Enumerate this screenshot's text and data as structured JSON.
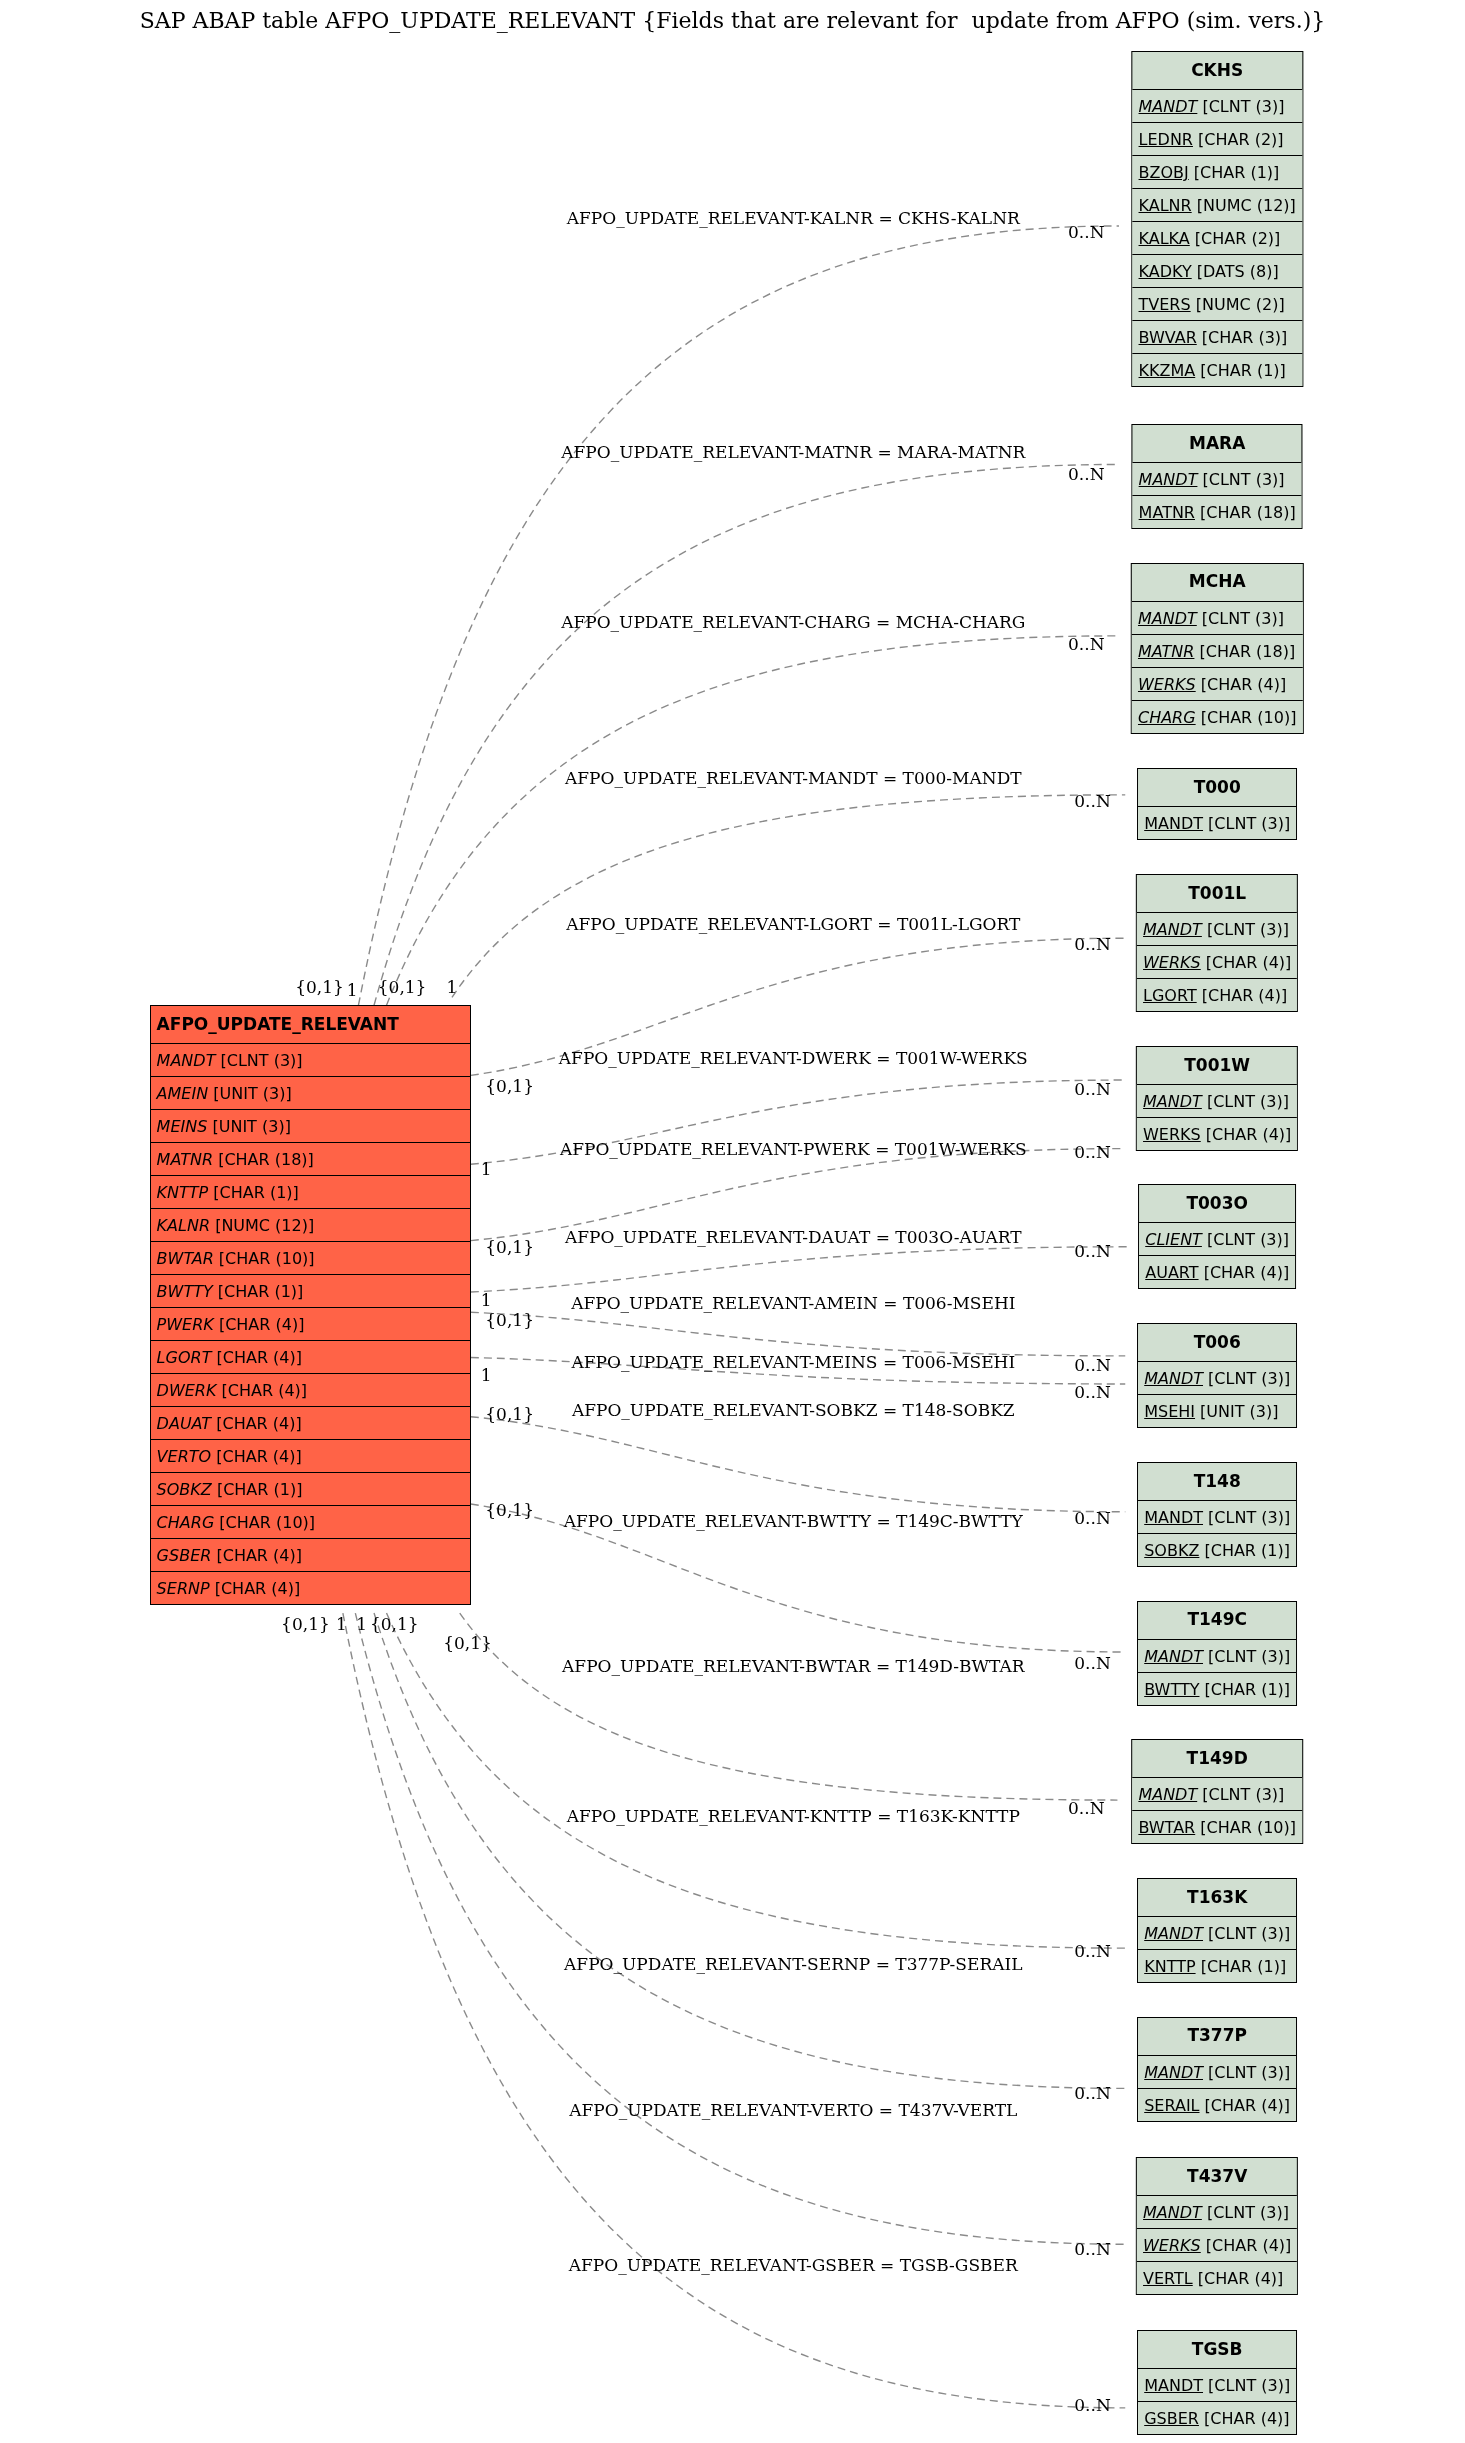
{
  "title": "SAP ABAP table AFPO_UPDATE_RELEVANT {Fields that are relevant for  update from AFPO (sim. vers.)}",
  "main_table": {
    "name": "AFPO_UPDATE_RELEVANT",
    "fields": [
      {
        "name": "MANDT",
        "type": "[CLNT (3)]",
        "italic": true,
        "underlined": false
      },
      {
        "name": "AMEIN",
        "type": "[UNIT (3)]",
        "italic": true,
        "underlined": false
      },
      {
        "name": "MEINS",
        "type": "[UNIT (3)]",
        "italic": true,
        "underlined": false
      },
      {
        "name": "MATNR",
        "type": "[CHAR (18)]",
        "italic": true,
        "underlined": false
      },
      {
        "name": "KNTTP",
        "type": "[CHAR (1)]",
        "italic": true,
        "underlined": false
      },
      {
        "name": "KALNR",
        "type": "[NUMC (12)]",
        "italic": true,
        "underlined": false
      },
      {
        "name": "BWTAR",
        "type": "[CHAR (10)]",
        "italic": true,
        "underlined": false
      },
      {
        "name": "BWTTY",
        "type": "[CHAR (1)]",
        "italic": true,
        "underlined": false
      },
      {
        "name": "PWERK",
        "type": "[CHAR (4)]",
        "italic": true,
        "underlined": false
      },
      {
        "name": "LGORT",
        "type": "[CHAR (4)]",
        "italic": true,
        "underlined": false
      },
      {
        "name": "DWERK",
        "type": "[CHAR (4)]",
        "italic": true,
        "underlined": false
      },
      {
        "name": "DAUAT",
        "type": "[CHAR (4)]",
        "italic": true,
        "underlined": false
      },
      {
        "name": "VERTO",
        "type": "[CHAR (4)]",
        "italic": true,
        "underlined": false
      },
      {
        "name": "SOBKZ",
        "type": "[CHAR (1)]",
        "italic": true,
        "underlined": false
      },
      {
        "name": "CHARG",
        "type": "[CHAR (10)]",
        "italic": true,
        "underlined": false
      },
      {
        "name": "GSBER",
        "type": "[CHAR (4)]",
        "italic": true,
        "underlined": false
      },
      {
        "name": "SERNP",
        "type": "[CHAR (4)]",
        "italic": true,
        "underlined": false
      }
    ]
  },
  "related_tables": [
    {
      "name": "CKHS",
      "fields": [
        {
          "name": "MANDT",
          "type": "[CLNT (3)]",
          "italic": true,
          "underlined": true
        },
        {
          "name": "LEDNR",
          "type": "[CHAR (2)]",
          "italic": false,
          "underlined": true
        },
        {
          "name": "BZOBJ",
          "type": "[CHAR (1)]",
          "italic": false,
          "underlined": true
        },
        {
          "name": "KALNR",
          "type": "[NUMC (12)]",
          "italic": false,
          "underlined": true
        },
        {
          "name": "KALKA",
          "type": "[CHAR (2)]",
          "italic": false,
          "underlined": true
        },
        {
          "name": "KADKY",
          "type": "[DATS (8)]",
          "italic": false,
          "underlined": true
        },
        {
          "name": "TVERS",
          "type": "[NUMC (2)]",
          "italic": false,
          "underlined": true
        },
        {
          "name": "BWVAR",
          "type": "[CHAR (3)]",
          "italic": false,
          "underlined": true
        },
        {
          "name": "KKZMA",
          "type": "[CHAR (1)]",
          "italic": false,
          "underlined": true
        }
      ]
    },
    {
      "name": "MARA",
      "fields": [
        {
          "name": "MANDT",
          "type": "[CLNT (3)]",
          "italic": true,
          "underlined": true
        },
        {
          "name": "MATNR",
          "type": "[CHAR (18)]",
          "italic": false,
          "underlined": true
        }
      ]
    },
    {
      "name": "MCHA",
      "fields": [
        {
          "name": "MANDT",
          "type": "[CLNT (3)]",
          "italic": true,
          "underlined": true
        },
        {
          "name": "MATNR",
          "type": "[CHAR (18)]",
          "italic": true,
          "underlined": true
        },
        {
          "name": "WERKS",
          "type": "[CHAR (4)]",
          "italic": true,
          "underlined": true
        },
        {
          "name": "CHARG",
          "type": "[CHAR (10)]",
          "italic": true,
          "underlined": true
        }
      ]
    },
    {
      "name": "T000",
      "fields": [
        {
          "name": "MANDT",
          "type": "[CLNT (3)]",
          "italic": false,
          "underlined": true
        }
      ]
    },
    {
      "name": "T001L",
      "fields": [
        {
          "name": "MANDT",
          "type": "[CLNT (3)]",
          "italic": true,
          "underlined": true
        },
        {
          "name": "WERKS",
          "type": "[CHAR (4)]",
          "italic": true,
          "underlined": true
        },
        {
          "name": "LGORT",
          "type": "[CHAR (4)]",
          "italic": false,
          "underlined": true
        }
      ]
    },
    {
      "name": "T001W",
      "fields": [
        {
          "name": "MANDT",
          "type": "[CLNT (3)]",
          "italic": true,
          "underlined": true
        },
        {
          "name": "WERKS",
          "type": "[CHAR (4)]",
          "italic": false,
          "underlined": true
        }
      ]
    },
    {
      "name": "T003O",
      "fields": [
        {
          "name": "CLIENT",
          "type": "[CLNT (3)]",
          "italic": true,
          "underlined": true
        },
        {
          "name": "AUART",
          "type": "[CHAR (4)]",
          "italic": false,
          "underlined": true
        }
      ]
    },
    {
      "name": "T006",
      "fields": [
        {
          "name": "MANDT",
          "type": "[CLNT (3)]",
          "italic": true,
          "underlined": true
        },
        {
          "name": "MSEHI",
          "type": "[UNIT (3)]",
          "italic": false,
          "underlined": true
        }
      ]
    },
    {
      "name": "T148",
      "fields": [
        {
          "name": "MANDT",
          "type": "[CLNT (3)]",
          "italic": false,
          "underlined": true
        },
        {
          "name": "SOBKZ",
          "type": "[CHAR (1)]",
          "italic": false,
          "underlined": true
        }
      ]
    },
    {
      "name": "T149C",
      "fields": [
        {
          "name": "MANDT",
          "type": "[CLNT (3)]",
          "italic": true,
          "underlined": true
        },
        {
          "name": "BWTTY",
          "type": "[CHAR (1)]",
          "italic": false,
          "underlined": true
        }
      ]
    },
    {
      "name": "T149D",
      "fields": [
        {
          "name": "MANDT",
          "type": "[CLNT (3)]",
          "italic": true,
          "underlined": true
        },
        {
          "name": "BWTAR",
          "type": "[CHAR (10)]",
          "italic": false,
          "underlined": true
        }
      ]
    },
    {
      "name": "T163K",
      "fields": [
        {
          "name": "MANDT",
          "type": "[CLNT (3)]",
          "italic": true,
          "underlined": true
        },
        {
          "name": "KNTTP",
          "type": "[CHAR (1)]",
          "italic": false,
          "underlined": true
        }
      ]
    },
    {
      "name": "T377P",
      "fields": [
        {
          "name": "MANDT",
          "type": "[CLNT (3)]",
          "italic": true,
          "underlined": true
        },
        {
          "name": "SERAIL",
          "type": "[CHAR (4)]",
          "italic": false,
          "underlined": true
        }
      ]
    },
    {
      "name": "T437V",
      "fields": [
        {
          "name": "MANDT",
          "type": "[CLNT (3)]",
          "italic": true,
          "underlined": true
        },
        {
          "name": "WERKS",
          "type": "[CHAR (4)]",
          "italic": true,
          "underlined": true
        },
        {
          "name": "VERTL",
          "type": "[CHAR (4)]",
          "italic": false,
          "underlined": true
        }
      ]
    },
    {
      "name": "TGSB",
      "fields": [
        {
          "name": "MANDT",
          "type": "[CLNT (3)]",
          "italic": false,
          "underlined": true
        },
        {
          "name": "GSBER",
          "type": "[CHAR (4)]",
          "italic": false,
          "underlined": true
        }
      ]
    }
  ],
  "relations": [
    {
      "label": "AFPO_UPDATE_RELEVANT-KALNR = CKHS-KALNR",
      "source_cardinality": "{0,1}",
      "target_cardinality": "0..N"
    },
    {
      "label": "AFPO_UPDATE_RELEVANT-MATNR = MARA-MATNR",
      "source_cardinality": "1",
      "target_cardinality": "0..N"
    },
    {
      "label": "AFPO_UPDATE_RELEVANT-CHARG = MCHA-CHARG",
      "source_cardinality": "{0,1}",
      "target_cardinality": "0..N"
    },
    {
      "label": "AFPO_UPDATE_RELEVANT-MANDT = T000-MANDT",
      "source_cardinality": "1",
      "target_cardinality": "0..N"
    },
    {
      "label": "AFPO_UPDATE_RELEVANT-LGORT = T001L-LGORT",
      "source_cardinality": "{0,1}",
      "target_cardinality": "0..N"
    },
    {
      "label": "AFPO_UPDATE_RELEVANT-DWERK = T001W-WERKS",
      "source_cardinality": "1",
      "target_cardinality": "0..N"
    },
    {
      "label": "AFPO_UPDATE_RELEVANT-PWERK = T001W-WERKS",
      "source_cardinality": "{0,1}",
      "target_cardinality": "0..N"
    },
    {
      "label": "AFPO_UPDATE_RELEVANT-DAUAT = T003O-AUART",
      "source_cardinality": "1",
      "target_cardinality": "0..N"
    },
    {
      "label": "AFPO_UPDATE_RELEVANT-AMEIN = T006-MSEHI",
      "source_cardinality": "{0,1}",
      "target_cardinality": "0..N"
    },
    {
      "label": "AFPO_UPDATE_RELEVANT-MEINS = T006-MSEHI",
      "source_cardinality": "1",
      "target_cardinality": "0..N"
    },
    {
      "label": "AFPO_UPDATE_RELEVANT-SOBKZ = T148-SOBKZ",
      "source_cardinality": "{0,1}",
      "target_cardinality": "0..N"
    },
    {
      "label": "AFPO_UPDATE_RELEVANT-BWTTY = T149C-BWTTY",
      "source_cardinality": "{0,1}",
      "target_cardinality": "0..N"
    },
    {
      "label": "AFPO_UPDATE_RELEVANT-BWTAR = T149D-BWTAR",
      "source_cardinality": "{0,1}",
      "target_cardinality": "0..N"
    },
    {
      "label": "AFPO_UPDATE_RELEVANT-KNTTP = T163K-KNTTP",
      "source_cardinality": "{0,1}",
      "target_cardinality": "0..N"
    },
    {
      "label": "AFPO_UPDATE_RELEVANT-SERNP = T377P-SERAIL",
      "source_cardinality": "1",
      "target_cardinality": "0..N"
    },
    {
      "label": "AFPO_UPDATE_RELEVANT-VERTO = T437V-VERTL",
      "source_cardinality": "1",
      "target_cardinality": "0..N"
    },
    {
      "label": "AFPO_UPDATE_RELEVANT-GSBER = TGSB-GSBER",
      "source_cardinality": "{0,1}",
      "target_cardinality": "0..N"
    }
  ]
}
